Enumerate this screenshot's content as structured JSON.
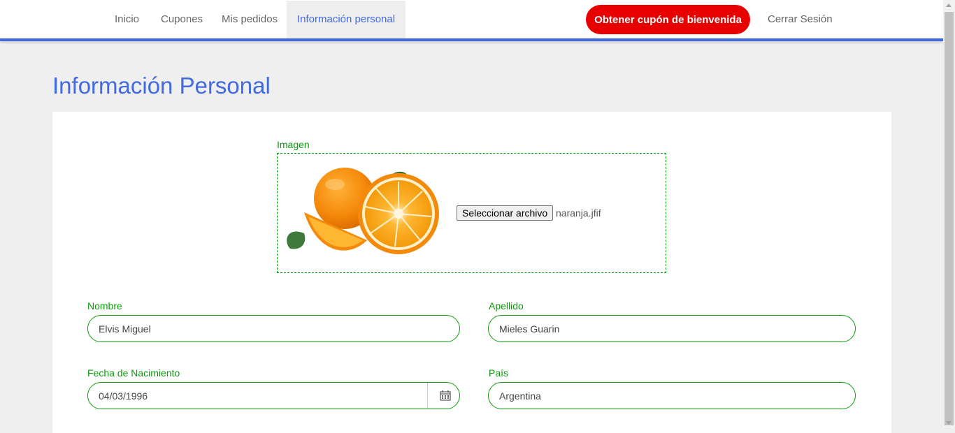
{
  "nav": {
    "items": [
      {
        "label": "Inicio",
        "active": false
      },
      {
        "label": "Cupones",
        "active": false
      },
      {
        "label": "Mis pedidos",
        "active": false
      },
      {
        "label": "Información personal",
        "active": true
      }
    ],
    "cta_label": "Obtener cupón de bienvenida",
    "logout_label": "Cerrar Sesión"
  },
  "colors": {
    "accent": "#4169e1",
    "cta": "#e60000",
    "field_border": "#0a9b0a"
  },
  "page": {
    "title": "Información Personal"
  },
  "form": {
    "image": {
      "label": "Imagen",
      "button_label": "Seleccionar archivo",
      "file_name": "naranja.jfif"
    },
    "nombre": {
      "label": "Nombre",
      "value": "Elvis Miguel"
    },
    "apellido": {
      "label": "Apellido",
      "value": "Mieles Guarin"
    },
    "fecha": {
      "label": "Fecha de Nacimiento",
      "value": "04/03/1996",
      "icon": "calendar-icon"
    },
    "pais": {
      "label": "País",
      "value": "Argentina"
    }
  }
}
